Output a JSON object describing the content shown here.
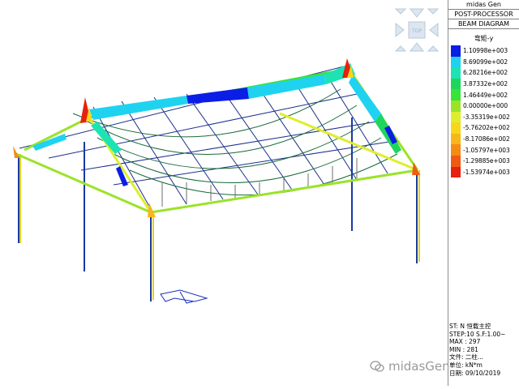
{
  "panel": {
    "header": [
      "midas Gen",
      "POST-PROCESSOR",
      "BEAM DIAGRAM"
    ],
    "legend_title": "弯矩-y",
    "legend": [
      {
        "label": "1.10998e+003",
        "color": "#0a1ee6"
      },
      {
        "label": "8.69099e+002",
        "color": "#1fd3f0"
      },
      {
        "label": "6.28216e+002",
        "color": "#1ce3b3"
      },
      {
        "label": "3.87332e+002",
        "color": "#1ed65c"
      },
      {
        "label": "1.46449e+002",
        "color": "#37e43a"
      },
      {
        "label": "0.00000e+000",
        "color": "#9be329"
      },
      {
        "label": "-3.35319e+002",
        "color": "#dfee2c"
      },
      {
        "label": "-5.76202e+002",
        "color": "#f7d71a"
      },
      {
        "label": "-8.17086e+002",
        "color": "#f7b71a"
      },
      {
        "label": "-1.05797e+003",
        "color": "#f58b14"
      },
      {
        "label": "-1.29885e+003",
        "color": "#f05a12"
      },
      {
        "label": "-1.53974e+003",
        "color": "#e8200f"
      }
    ],
    "info": [
      "ST: N 恒载主控",
      "STEP:10 S.F:1.00~",
      "MAX : 297",
      "MIN : 281",
      "文件: 二柱...",
      "单位: kN*m",
      "日期: 09/10/2019"
    ]
  },
  "view_cube": {
    "label": "TOP"
  },
  "watermark": {
    "text": "midasGen小饭专家"
  }
}
